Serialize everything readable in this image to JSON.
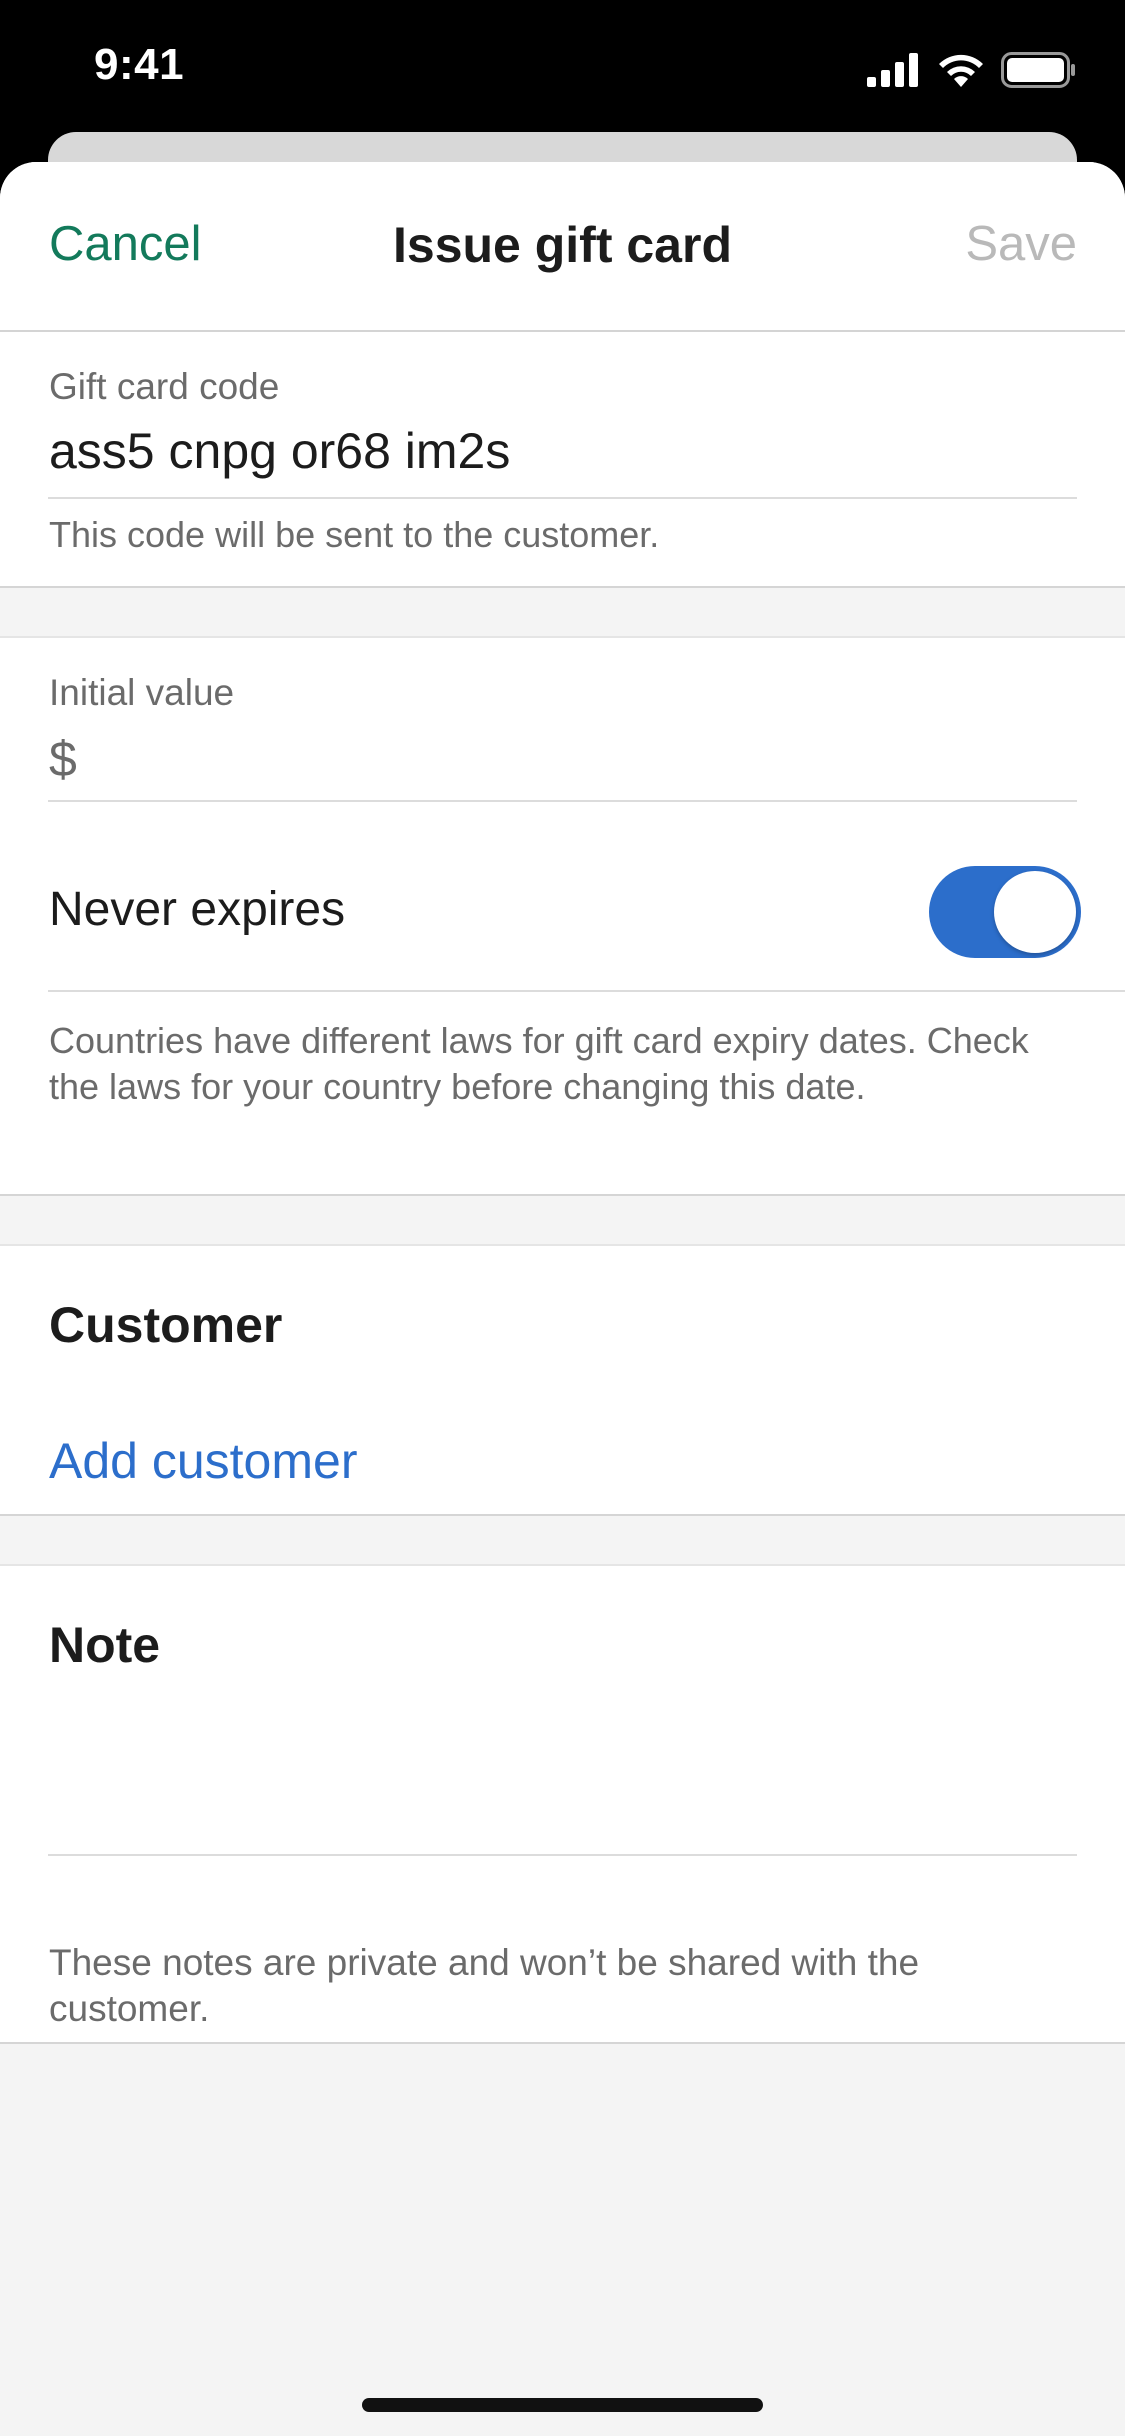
{
  "status_bar": {
    "time": "9:41"
  },
  "navbar": {
    "cancel_label": "Cancel",
    "title": "Issue gift card",
    "save_label": "Save"
  },
  "gift_card_code": {
    "label": "Gift card code",
    "value": "ass5 cnpg or68 im2s",
    "help": "This code will be sent to the customer."
  },
  "initial_value": {
    "label": "Initial value",
    "currency_symbol": "$"
  },
  "expiry": {
    "label": "Never expires",
    "toggle_on": true,
    "help": "Countries have different laws for gift card expiry dates. Check the laws for your country before changing this date."
  },
  "customer": {
    "title": "Customer",
    "add_label": "Add customer"
  },
  "note": {
    "title": "Note",
    "help": "These notes are private and won’t be shared with the customer."
  },
  "colors": {
    "accent_green": "#137a5b",
    "accent_blue": "#2c6ecb",
    "disabled": "#b9b9b9"
  }
}
